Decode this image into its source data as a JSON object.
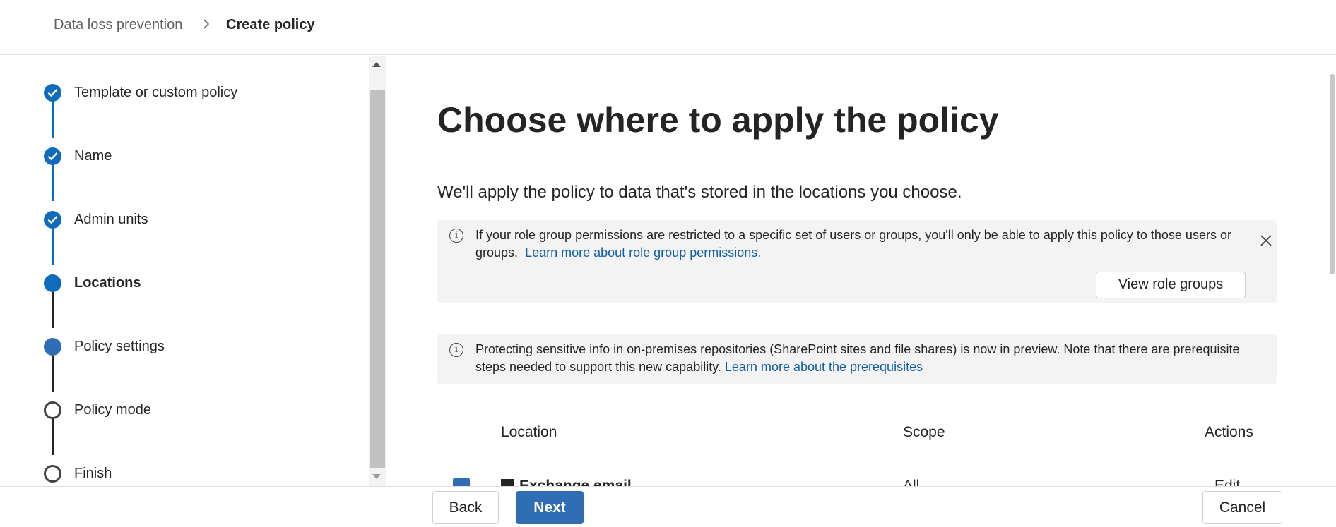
{
  "breadcrumb": {
    "parent": "Data loss prevention",
    "separator": "›",
    "current": "Create policy"
  },
  "steps": [
    {
      "label": "Template or custom policy",
      "state": "completed"
    },
    {
      "label": "Name",
      "state": "completed"
    },
    {
      "label": "Admin units",
      "state": "completed"
    },
    {
      "label": "Locations",
      "state": "current"
    },
    {
      "label": "Policy settings",
      "state": "upcoming-filled"
    },
    {
      "label": "Policy mode",
      "state": "not-started"
    },
    {
      "label": "Finish",
      "state": "not-started"
    }
  ],
  "main": {
    "title": "Choose where to apply the policy",
    "subtitle": "We'll apply the policy to data that's stored in the locations you choose.",
    "info_role": {
      "text": "If your role group permissions are restricted to a specific set of users or groups, you'll only be able to apply this policy to those users or groups.",
      "link": "Learn more about role group permissions.",
      "button": "View role groups"
    },
    "info_onprem": {
      "text": "Protecting sensitive info in on-premises repositories (SharePoint sites and file shares) is now in preview. Note that there are prerequisite steps needed to support this new capability.",
      "link": "Learn more about the prerequisites"
    },
    "table": {
      "headers": {
        "location": "Location",
        "scope": "Scope",
        "actions": "Actions"
      },
      "rows": [
        {
          "location": "Exchange email",
          "scope": "All",
          "action": "Edit"
        }
      ]
    }
  },
  "footer": {
    "back": "Back",
    "next": "Next",
    "cancel": "Cancel"
  },
  "colors": {
    "accent": "#0f6cbd",
    "primary_button": "#2f6db5",
    "link": "#115ea3",
    "info_background": "#f3f3f3"
  }
}
